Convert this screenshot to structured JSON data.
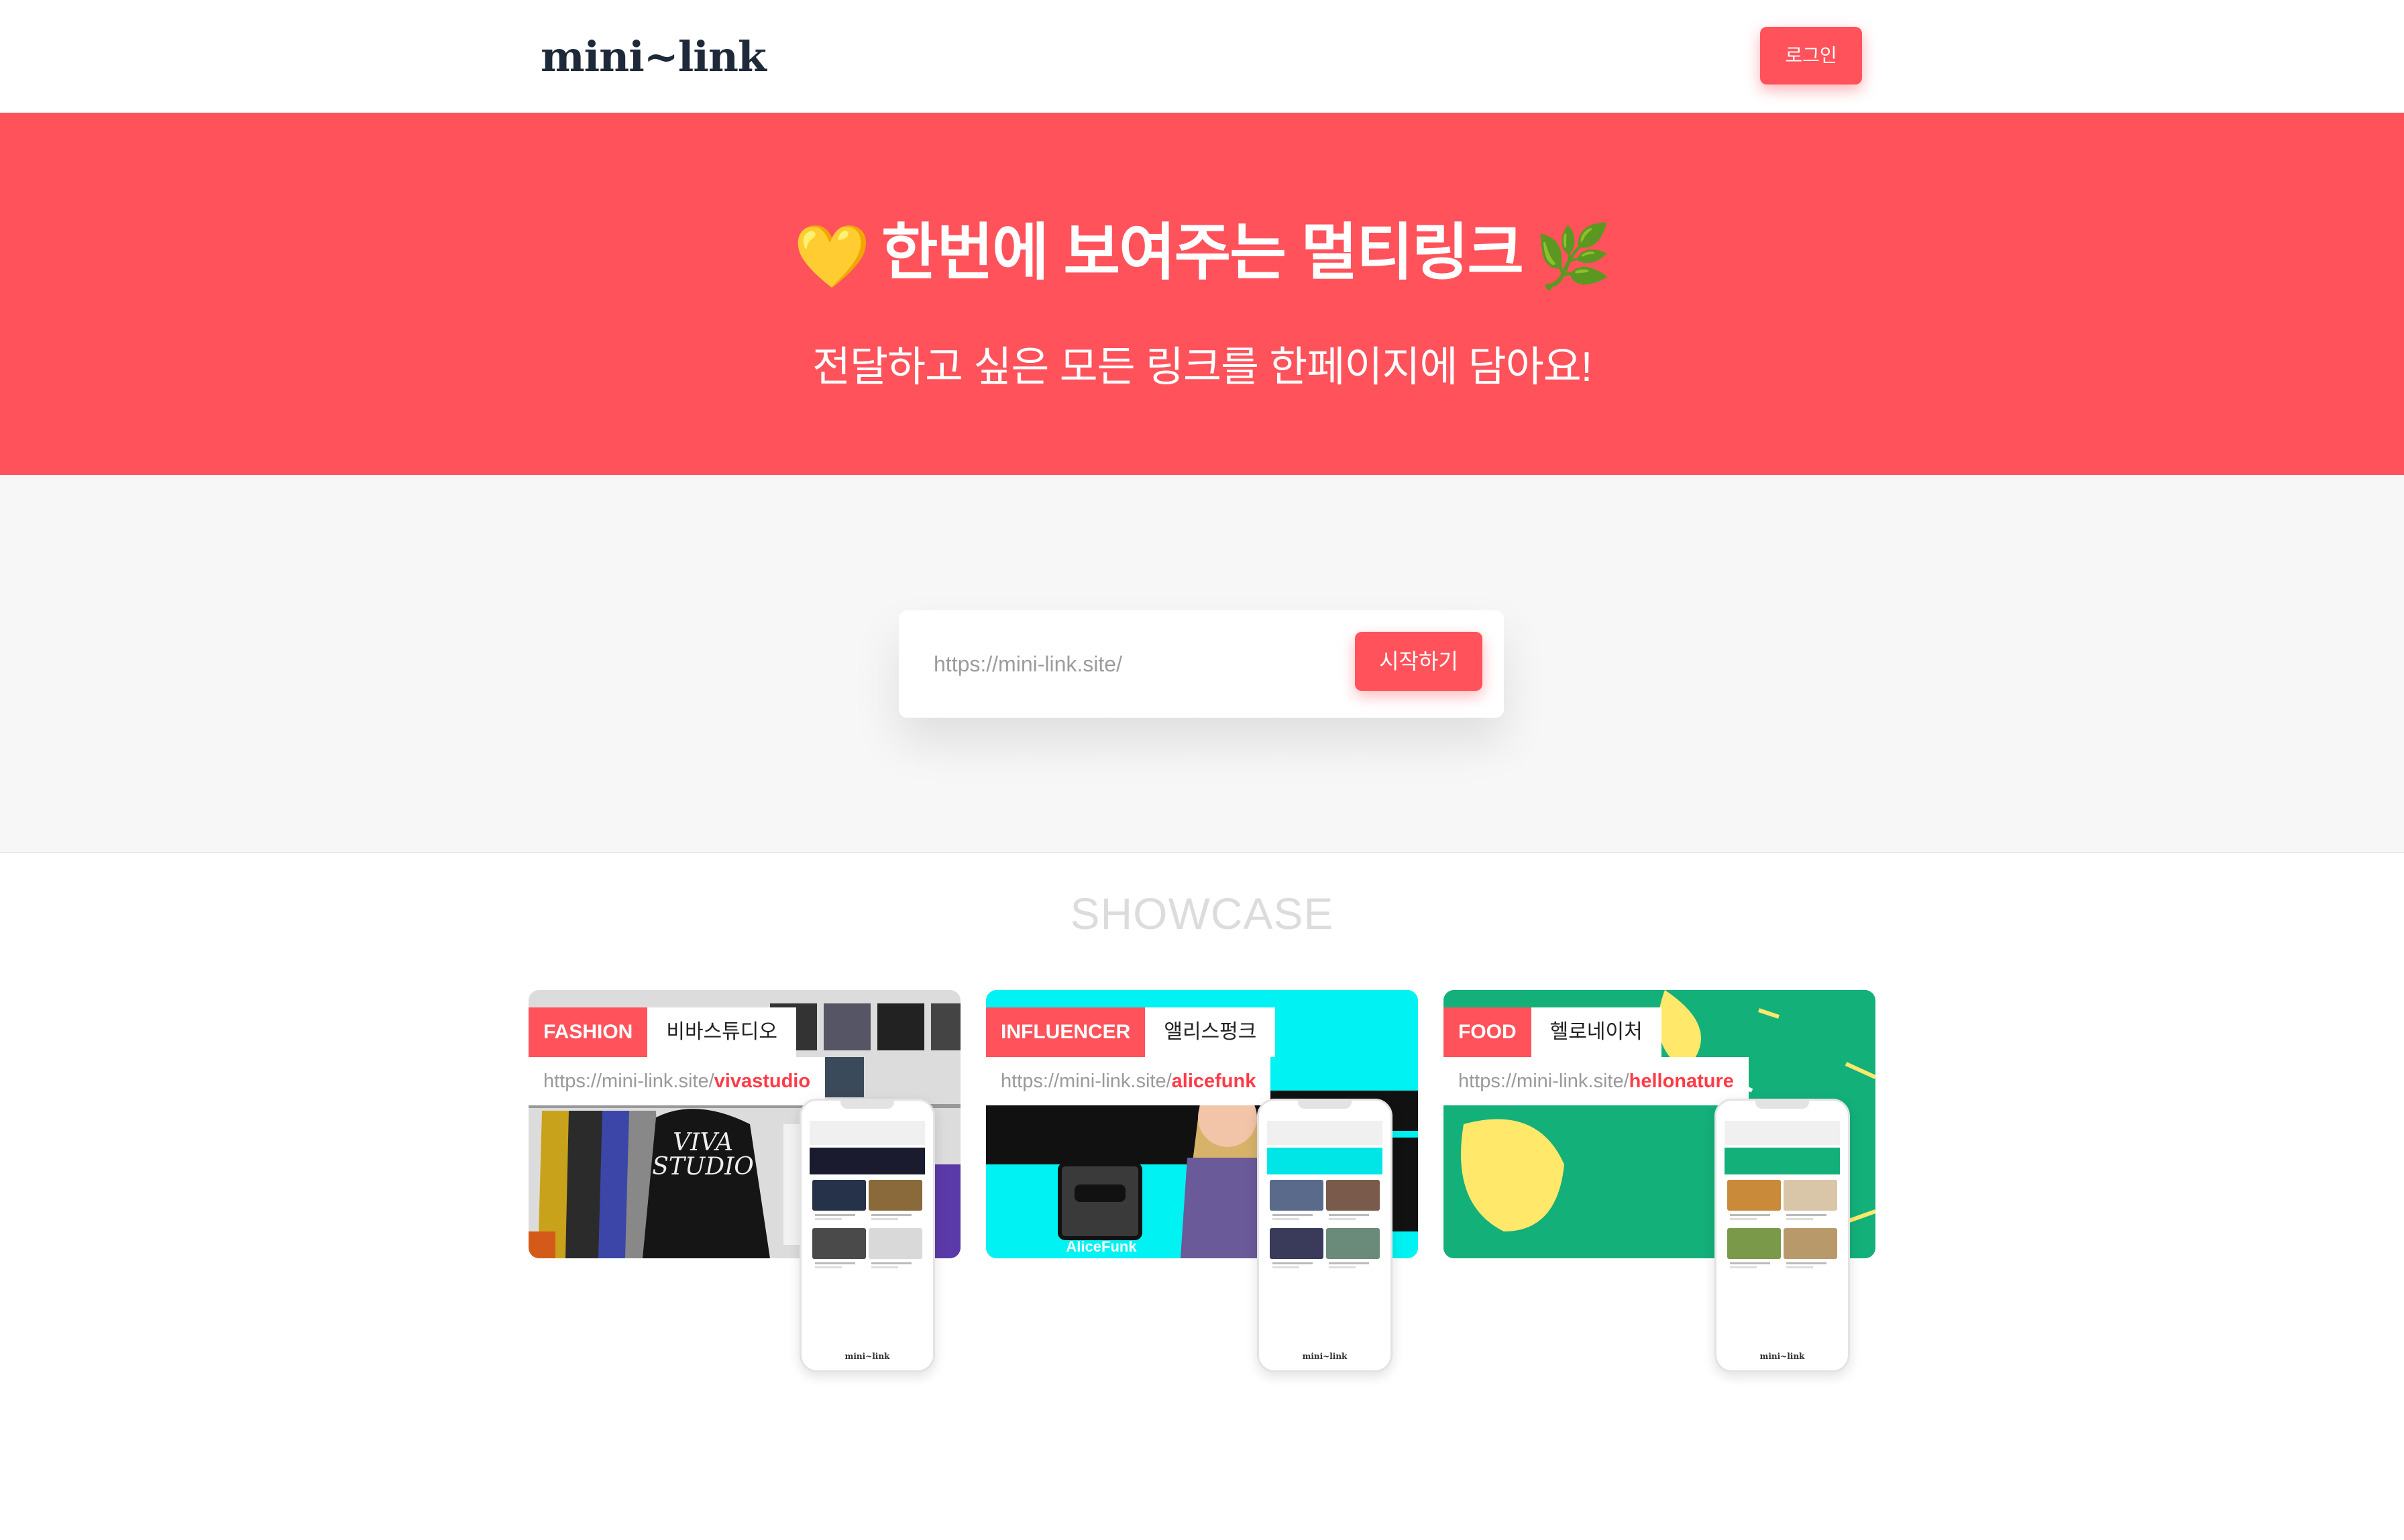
{
  "header": {
    "logo": "mini~link",
    "login_label": "로그인"
  },
  "hero": {
    "title": "한번에 보여주는 멀티링크",
    "emoji_left": "💛",
    "emoji_right": "🌿",
    "subtitle": "전달하고 싶은 모든 링크를 한페이지에 담아요!"
  },
  "start": {
    "placeholder": "https://mini-link.site/",
    "button_label": "시작하기"
  },
  "showcase": {
    "title": "SHOWCASE",
    "url_prefix": "https://mini-link.site/",
    "phone_footer": "mini~link",
    "cards": [
      {
        "category": "FASHION",
        "name": "비바스튜디오",
        "slug": "vivastudio",
        "image_text": "VIVA STUDIO"
      },
      {
        "category": "INFLUENCER",
        "name": "앨리스펑크",
        "slug": "alicefunk",
        "image_text": "AliceFunk"
      },
      {
        "category": "FOOD",
        "name": "헬로네이처",
        "slug": "hellonature",
        "image_text": ""
      }
    ]
  },
  "colors": {
    "brand": "#ff525b",
    "logo": "#1e2a3a",
    "section_bg": "#f7f7f7",
    "showcase_title": "#dcdcdc"
  }
}
